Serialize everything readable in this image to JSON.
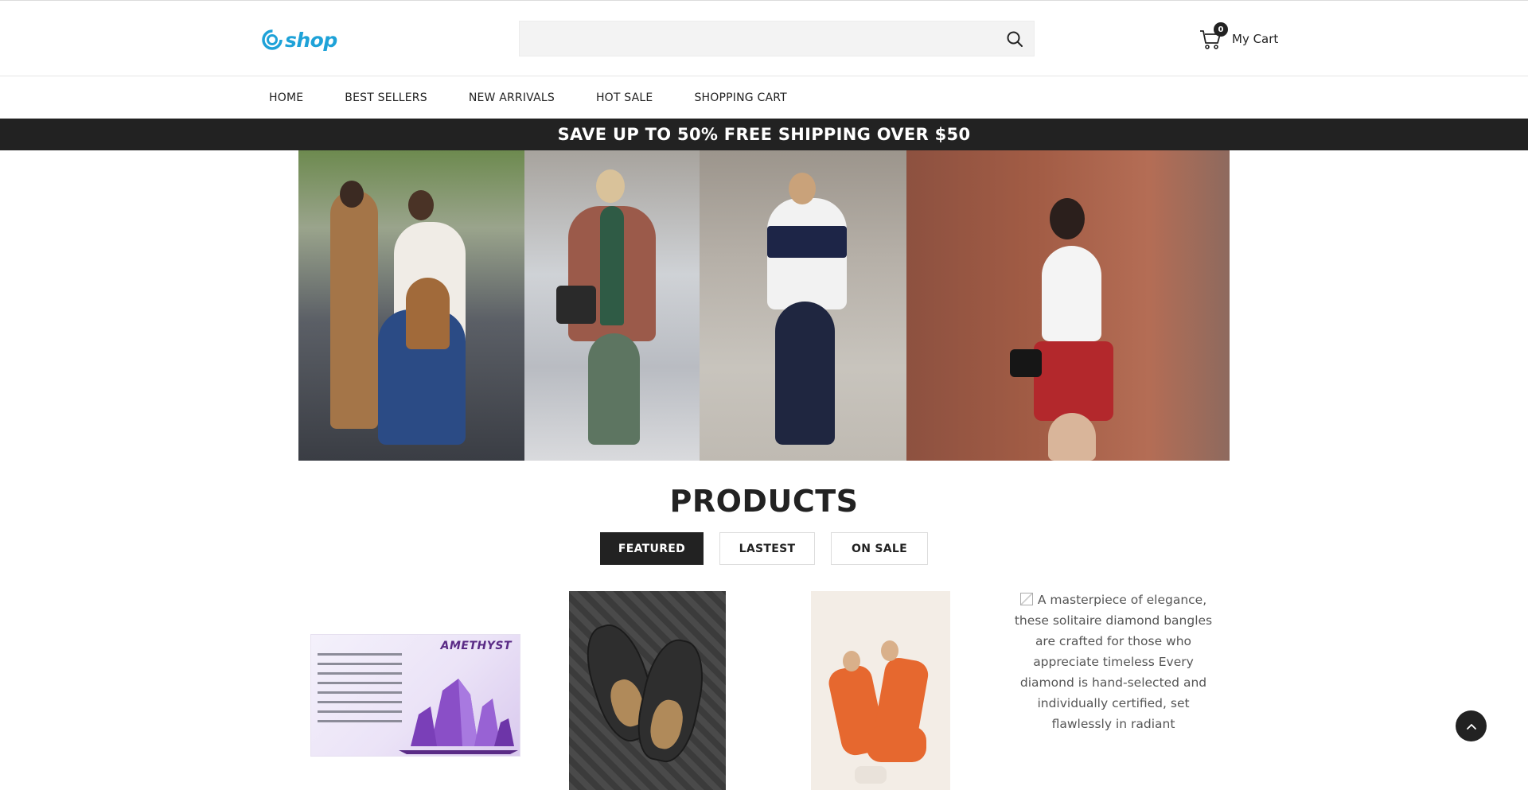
{
  "header": {
    "logo_text": "shop",
    "search": {
      "placeholder": "",
      "value": ""
    },
    "cart": {
      "count": "0",
      "label": "My Cart"
    }
  },
  "nav": {
    "items": [
      {
        "label": "HOME"
      },
      {
        "label": "BEST SELLERS"
      },
      {
        "label": "NEW ARRIVALS"
      },
      {
        "label": "HOT SALE"
      },
      {
        "label": "SHOPPING CART"
      }
    ]
  },
  "promo": {
    "text": "SAVE UP TO 50% FREE SHIPPING OVER $50"
  },
  "products": {
    "title": "PRODUCTS",
    "tabs": [
      {
        "label": "FEATURED",
        "active": true
      },
      {
        "label": "LASTEST",
        "active": false
      },
      {
        "label": "ON SALE",
        "active": false
      }
    ],
    "items": [
      {
        "image_label": "AMETHYST"
      },
      {
        "image_label": ""
      },
      {
        "image_label": ""
      },
      {
        "alt_text": "A masterpiece of elegance, these solitaire diamond bangles are crafted for those who appreciate timeless Every diamond is hand-selected and individually certified, set flawlessly in radiant"
      }
    ]
  },
  "colors": {
    "brand": "#1ea2d8",
    "dark": "#222222",
    "promo_bg": "#222222"
  },
  "icons": {
    "logo": "swirl-logo-icon",
    "search": "search-icon",
    "cart": "cart-icon",
    "back_to_top": "chevron-up-icon"
  }
}
